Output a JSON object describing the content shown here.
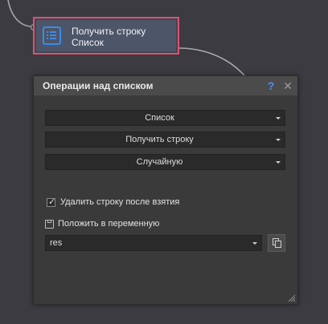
{
  "node": {
    "title": "Получить строку",
    "subtitle": "Список",
    "icon": "list-icon",
    "border_color": "#e0506a",
    "icon_color": "#3d8be8"
  },
  "dialog": {
    "title": "Операции над списком",
    "help_label": "?",
    "close_label": "✕",
    "help_color": "#4a8ff5",
    "combos": [
      {
        "value": "Список"
      },
      {
        "value": "Получить строку"
      },
      {
        "value": "Случайную"
      }
    ],
    "remove_after_take": {
      "label": "Удалить строку после взятия",
      "checked": true,
      "mark": "✓"
    },
    "save_to_var": {
      "label": "Положить в переменную",
      "icon": "save-icon",
      "value": "res",
      "copy_icon": "copy-icon"
    },
    "resize_icon": "resize-grip-icon"
  }
}
